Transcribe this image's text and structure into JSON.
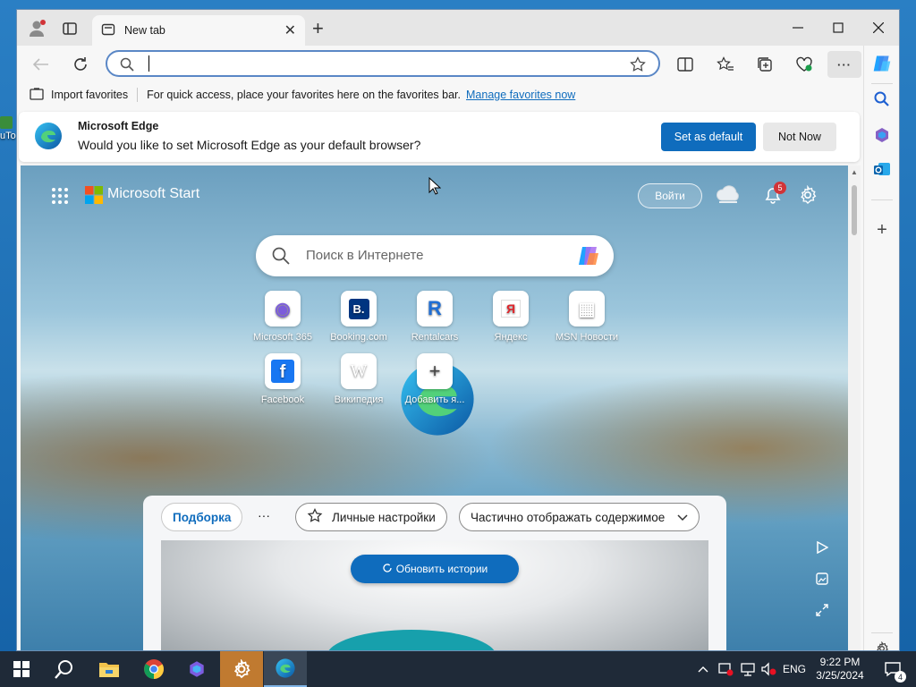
{
  "browser": {
    "tab_title": "New tab",
    "address_value": "",
    "favorites_bar": {
      "import_label": "Import favorites",
      "hint_text": "For quick access, place your favorites here on the favorites bar.",
      "manage_link": "Manage favorites now"
    },
    "default_banner": {
      "title": "Microsoft Edge",
      "message": "Would you like to set Microsoft Edge as your default browser?",
      "set_default_label": "Set as default",
      "not_now_label": "Not Now"
    }
  },
  "newtab": {
    "brand": "Microsoft Start",
    "signin_label": "Войти",
    "notification_count": "5",
    "search_placeholder": "Поиск в Интернете",
    "quick_links": [
      {
        "label": "Microsoft 365",
        "icon_text": "◉"
      },
      {
        "label": "Booking.com",
        "icon_text": "B."
      },
      {
        "label": "Rentalcars",
        "icon_text": "R"
      },
      {
        "label": "Яндекс",
        "icon_text": "Я"
      },
      {
        "label": "MSN Новости",
        "icon_text": "▦"
      },
      {
        "label": "Facebook",
        "icon_text": "f"
      },
      {
        "label": "Википедия",
        "icon_text": "W"
      },
      {
        "label": "Добавить я...",
        "icon_text": "+"
      }
    ],
    "feed": {
      "tab_label": "Подборка",
      "more_label": "···",
      "personalize_label": "Личные настройки",
      "display_label": "Частично отображать содержимое",
      "refresh_label": "Обновить истории"
    }
  },
  "taskbar": {
    "language": "ENG",
    "time": "9:22 PM",
    "date": "3/25/2024",
    "notification_badge": "4"
  },
  "desktop": {
    "icon_label": "uTo"
  },
  "colors": {
    "accent": "#0f6cbd",
    "taskbar": "#1f2a38",
    "notification_badge": "#d13438"
  }
}
